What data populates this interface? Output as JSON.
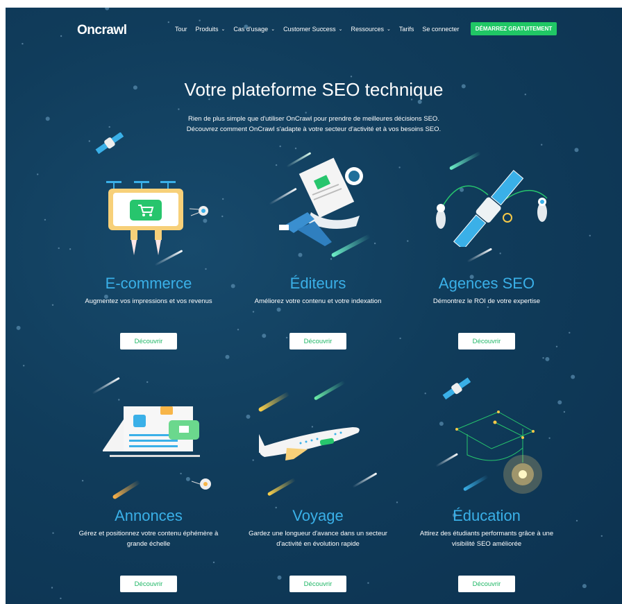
{
  "nav": {
    "logo": "Oncrawl",
    "menu": [
      {
        "label": "Tour",
        "dropdown": false
      },
      {
        "label": "Produits",
        "dropdown": true
      },
      {
        "label": "Cas d'usage",
        "dropdown": true
      },
      {
        "label": "Customer Success",
        "dropdown": true
      },
      {
        "label": "Ressources",
        "dropdown": true
      },
      {
        "label": "Tarifs",
        "dropdown": false
      },
      {
        "label": "Se connecter",
        "dropdown": false
      }
    ],
    "cta": "DÉMARREZ GRATUITEMENT",
    "chevron_glyph": "⌄"
  },
  "hero": {
    "title": "Votre plateforme SEO technique",
    "line1": "Rien de plus simple que d'utiliser OnCrawl pour prendre de meilleures décisions SEO.",
    "line2": "Découvrez comment OnCrawl s'adapte à votre secteur d'activité et à vos besoins SEO."
  },
  "cards": [
    {
      "title": "E-commerce",
      "desc": "Augmentez vos impressions et vos revenus",
      "button": "Découvrir",
      "icon": "billboard-satellite-icon"
    },
    {
      "title": "Éditeurs",
      "desc": "Améliorez votre contenu et votre indexation",
      "button": "Découvrir",
      "icon": "astronaut-reading-icon"
    },
    {
      "title": "Agences SEO",
      "desc": "Démontrez le ROI de votre expertise",
      "button": "Découvrir",
      "icon": "satellite-astronauts-icon"
    },
    {
      "title": "Annonces",
      "desc": "Gérez et positionnez votre contenu éphémère à grande échelle",
      "button": "Découvrir",
      "icon": "listing-board-icon"
    },
    {
      "title": "Voyage",
      "desc": "Gardez une longueur d'avance dans un secteur d'activité en évolution rapide",
      "button": "Découvrir",
      "icon": "airplane-icon"
    },
    {
      "title": "Éducation",
      "desc": "Attirez des étudiants performants grâce à une visibilité SEO améliorée",
      "button": "Découvrir",
      "icon": "graduation-cap-constellation-icon"
    }
  ],
  "colors": {
    "background": "#103c5b",
    "accent_green": "#20c765",
    "title_blue": "#3ab0e8"
  }
}
